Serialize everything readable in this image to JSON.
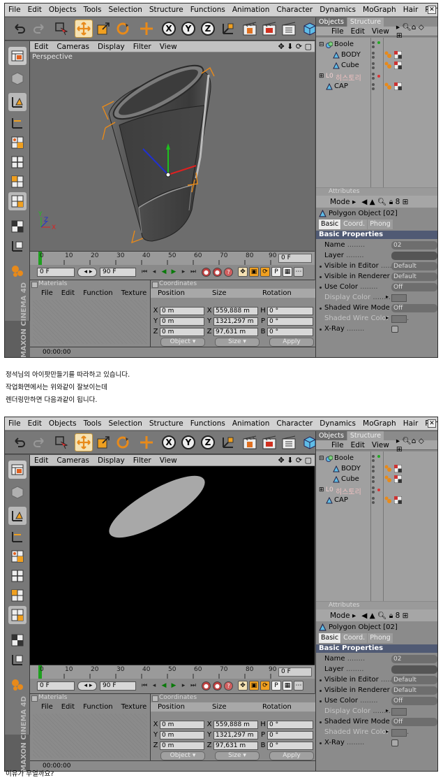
{
  "screenshots": [
    {
      "menu": [
        "File",
        "Edit",
        "Objects",
        "Tools",
        "Selection",
        "Structure",
        "Functions",
        "Animation",
        "Character",
        "Dynamics",
        "MoGraph",
        "Hair",
        "Render"
      ],
      "viewport_menu": [
        "Edit",
        "Cameras",
        "Display",
        "Filter",
        "View"
      ],
      "viewport_label": "Perspective",
      "object_tabs": [
        "Objects",
        "Structure"
      ],
      "object_menu": [
        "File",
        "Edit",
        "View"
      ],
      "objects": [
        "Boole",
        "BODY",
        "Cube",
        "히스토리",
        "CAP"
      ],
      "timeline_ticks": [
        "0",
        "10",
        "20",
        "30",
        "40",
        "50",
        "60",
        "70",
        "80",
        "90"
      ],
      "frame_end_field": "0 F",
      "frame_start": "0 F",
      "frame_total": "90 F",
      "materials_title": "Materials",
      "materials_menu": [
        "File",
        "Edit",
        "Function",
        "Texture"
      ],
      "coords_title": "Coordinates",
      "coords_head": [
        "Position",
        "Size",
        "Rotation"
      ],
      "coords_rows": [
        {
          "axis": "X",
          "pos": "0 m",
          "saxis": "X",
          "size": "559,888 m",
          "raxis": "H",
          "rot": "0 °"
        },
        {
          "axis": "Y",
          "pos": "0 m",
          "saxis": "Y",
          "size": "1321,297 m",
          "raxis": "P",
          "rot": "0 °"
        },
        {
          "axis": "Z",
          "pos": "0 m",
          "saxis": "Z",
          "size": "97,631 m",
          "raxis": "B",
          "rot": "0 °"
        }
      ],
      "coord_buttons": [
        "Object",
        "Size",
        "Apply"
      ],
      "time": "00:00:00",
      "attr_title": "Attributes",
      "attr_mode": "Mode",
      "poly_name": "Polygon Object [02]",
      "subtabs": [
        "Basic",
        "Coord.",
        "Phong"
      ],
      "section": "Basic Properties",
      "attributes": [
        {
          "label": "Name",
          "value": "02"
        },
        {
          "label": "Layer",
          "value": ""
        },
        {
          "label": "Visible in Editor",
          "value": "Default"
        },
        {
          "label": "Visible in Renderer",
          "value": "Default"
        },
        {
          "label": "Use Color",
          "value": "Off"
        },
        {
          "label": "Display Color",
          "value": ""
        },
        {
          "label": "Shaded Wire Mode",
          "value": "Off"
        },
        {
          "label": "Shaded Wire Color",
          "value": ""
        },
        {
          "label": "X-Ray",
          "value": ""
        }
      ],
      "brand": "MAXON CINEMA 4D"
    },
    {
      "menu": [
        "File",
        "Edit",
        "Objects",
        "Tools",
        "Selection",
        "Structure",
        "Functions",
        "Animation",
        "Character",
        "Dynamics",
        "MoGraph",
        "Hair",
        "Render"
      ],
      "viewport_menu": [
        "Edit",
        "Cameras",
        "Display",
        "Filter",
        "View"
      ],
      "viewport_label": "",
      "object_tabs": [
        "Objects",
        "Structure"
      ],
      "object_menu": [
        "File",
        "Edit",
        "View"
      ],
      "objects": [
        "Boole",
        "BODY",
        "Cube",
        "히스토리",
        "CAP"
      ],
      "timeline_ticks": [
        "0",
        "10",
        "20",
        "30",
        "40",
        "50",
        "60",
        "70",
        "80",
        "90"
      ],
      "frame_end_field": "0 F",
      "frame_start": "0 F",
      "frame_total": "90 F",
      "materials_title": "Materials",
      "materials_menu": [
        "File",
        "Edit",
        "Function",
        "Texture"
      ],
      "coords_title": "Coordinates",
      "coords_head": [
        "Position",
        "Size",
        "Rotation"
      ],
      "coords_rows": [
        {
          "axis": "X",
          "pos": "0 m",
          "saxis": "X",
          "size": "559,888 m",
          "raxis": "H",
          "rot": "0 °"
        },
        {
          "axis": "Y",
          "pos": "0 m",
          "saxis": "Y",
          "size": "1321,297 m",
          "raxis": "P",
          "rot": "0 °"
        },
        {
          "axis": "Z",
          "pos": "0 m",
          "saxis": "Z",
          "size": "97,631 m",
          "raxis": "B",
          "rot": "0 °"
        }
      ],
      "coord_buttons": [
        "Object",
        "Size",
        "Apply"
      ],
      "time": "00:00:00",
      "attr_title": "Attributes",
      "attr_mode": "Mode",
      "poly_name": "Polygon Object [02]",
      "subtabs": [
        "Basic",
        "Coord.",
        "Phong"
      ],
      "section": "Basic Properties",
      "attributes": [
        {
          "label": "Name",
          "value": "02"
        },
        {
          "label": "Layer",
          "value": ""
        },
        {
          "label": "Visible in Editor",
          "value": "Default"
        },
        {
          "label": "Visible in Renderer",
          "value": "Default"
        },
        {
          "label": "Use Color",
          "value": "Off"
        },
        {
          "label": "Display Color",
          "value": ""
        },
        {
          "label": "Shaded Wire Mode",
          "value": "Off"
        },
        {
          "label": "Shaded Wire Color",
          "value": ""
        },
        {
          "label": "X-Ray",
          "value": ""
        }
      ],
      "brand": "MAXON CINEMA 4D"
    }
  ],
  "post": {
    "line1": "정석님의 아이팟만들기를 따라하고 있습니다.",
    "line2": "작업화면에서는 위와같이 잘보이는데",
    "line3": "렌더링만하면 다음과같이 됩니다.",
    "question": "이유가 무얼까요?"
  },
  "colors": {
    "accent_orange": "#e88a1a",
    "selection": "#f5e2b4",
    "section_header": "#505a74"
  }
}
